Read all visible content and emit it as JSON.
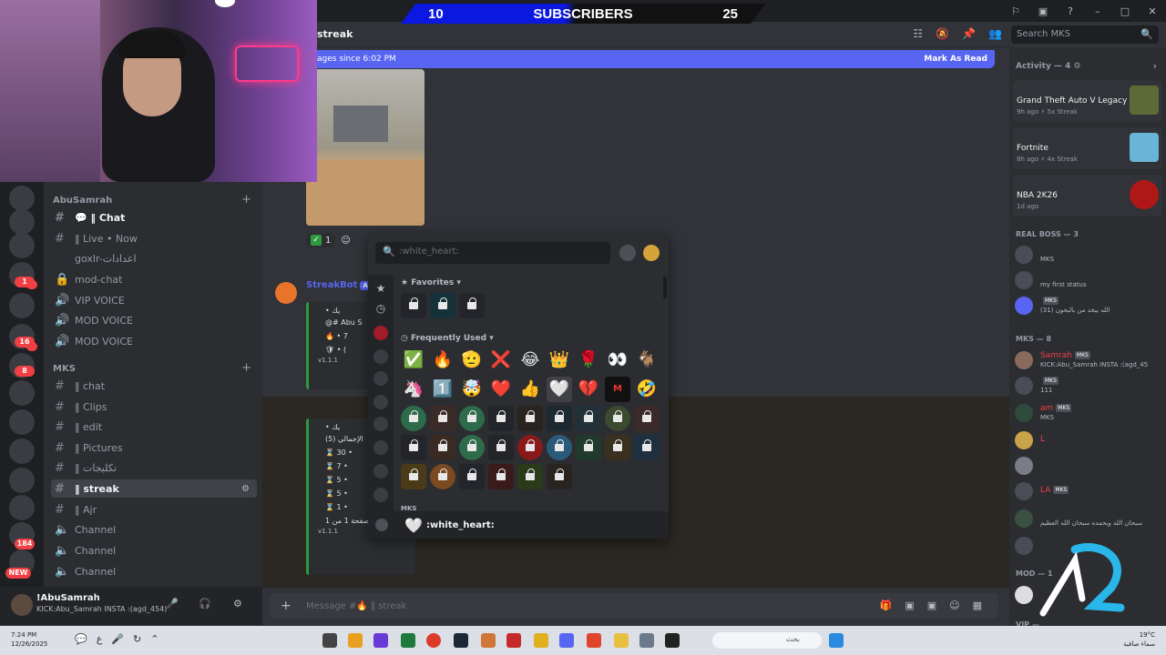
{
  "banner": {
    "left": "10",
    "center": "SUBSCRIBERS",
    "right": "25"
  },
  "window_controls": [
    "⚐",
    "▣",
    "?",
    "–",
    "□",
    "✕"
  ],
  "header": {
    "channel": "streak",
    "search_placeholder": "Search MKS"
  },
  "new_bar": {
    "text": "ages since 6:02 PM",
    "action": "Mark As Read"
  },
  "reactions": {
    "count": "1"
  },
  "bot": {
    "name": "StreakBot",
    "tag": "APP"
  },
  "embed1": {
    "rows": [
      "• يك",
      "@# Abu S",
      "🔥 • 7",
      "🛡 • ("
    ],
    "version": "v1.1.1"
  },
  "embed2": {
    "rows": [
      "• يك",
      "(5) الإجمالي",
      "⌛ 30 •",
      "⌛ 7 •",
      "⌛ 5 •",
      "⌛ 5 •",
      "⌛ 1 •"
    ],
    "page": "صفحة 1 من 1",
    "version": "v1.1.1"
  },
  "picker": {
    "search_placeholder": ":white_heart:",
    "favorites_label": "Favorites",
    "frequent_label": "Frequently Used",
    "next_label": "MKS",
    "footer_emoji": "🤍",
    "footer_text": ":white_heart:",
    "frequent_row1": [
      "✅",
      "🔥",
      "🫡",
      "❌",
      "😂",
      "👑",
      "🌹",
      "👀",
      "🐐"
    ],
    "frequent_row2": [
      "🦄",
      "1️⃣",
      "🤯",
      "❤️",
      "👍",
      "🤍",
      "💔",
      "M",
      "🤣"
    ]
  },
  "channels": {
    "category1": "AbuSamrah",
    "category2": "MKS",
    "items": [
      {
        "name": "💬 ‖ Chat",
        "bold": true
      },
      {
        "name": "‖ Live • Now",
        "bold": false
      },
      {
        "name": "goxlr-اعدادات",
        "bold": false
      },
      {
        "name": "mod-chat",
        "bold": false
      },
      {
        "name": "VIP VOICE",
        "bold": false
      },
      {
        "name": "MOD VOICE",
        "bold": false
      },
      {
        "name": "MOD VOICE",
        "bold": false
      },
      {
        "name": "‖ chat",
        "bold": false
      },
      {
        "name": "‖ Clips",
        "bold": false
      },
      {
        "name": "‖ edit",
        "bold": false
      },
      {
        "name": "‖ Pictures",
        "bold": false
      },
      {
        "name": "‖ تكليجات",
        "bold": false
      },
      {
        "name": "‖ streak",
        "bold": true
      },
      {
        "name": "‖ Ajr",
        "bold": false
      },
      {
        "name": "Channel",
        "bold": false
      },
      {
        "name": "Channel",
        "bold": false
      },
      {
        "name": "Channel",
        "bold": false
      }
    ]
  },
  "rail": {
    "badges": [
      "1",
      "16",
      "8",
      "184",
      "NEW"
    ]
  },
  "user": {
    "name": "!AbuSamrah",
    "status": "KICK:Abu_Samrah INSTA :(agd_454)"
  },
  "composer": {
    "placeholder": "Message #🔥 ‖ streak"
  },
  "members": {
    "activity_label": "Activity — 4",
    "activities": [
      {
        "title": "Grand Theft Auto V Legacy",
        "sub": "9h ago  ⚡ 5x Streak"
      },
      {
        "title": "Fortnite",
        "sub": "8h ago  ⚡ 4x Streak"
      },
      {
        "title": "NBA 2K26",
        "sub": "1d ago"
      }
    ],
    "group1": "REAL BOSS — 3",
    "group2": "MKS — 8",
    "group3": "MOD — 1",
    "group4": "VIP —",
    "mem_tag": "MKS",
    "mem_statuses": [
      "MKS",
      "my first status",
      "(31) الله يبحد من بالبحون",
      "KICK:Abu_Samrah INSTA :(agd_45",
      "111",
      "MKS",
      "سبحان الله وبحمده سبحان الله العظيم"
    ],
    "mem_names": [
      "",
      "",
      "",
      "Samrah",
      "",
      "am",
      "L",
      "",
      "LA",
      "",
      ""
    ]
  },
  "taskbar": {
    "time": "7:24 PM",
    "date": "12/26/2025",
    "search": "بحث",
    "temp": "19°C",
    "weather": "سماء صافية"
  },
  "colors": {
    "accent": "#5865f2",
    "online": "#23a55a",
    "dnd": "#f23f43",
    "banner_blue": "#0a18e0"
  }
}
